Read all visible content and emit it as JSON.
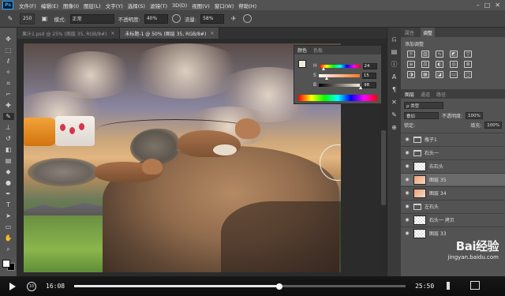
{
  "app": {
    "logo": "Ps"
  },
  "menu": [
    "文件(F)",
    "编辑(E)",
    "图像(I)",
    "图层(L)",
    "文字(Y)",
    "选择(S)",
    "滤镜(T)",
    "3D(D)",
    "视图(V)",
    "窗口(W)",
    "帮助(H)"
  ],
  "window_controls": {
    "minimize": "–",
    "maximize": "□",
    "close": "✕"
  },
  "options": {
    "brush_size": "250",
    "mode_label": "模式:",
    "mode_value": "正常",
    "opacity_label": "不透明度:",
    "opacity_value": "40%",
    "flow_label": "流量:",
    "flow_value": "58%"
  },
  "tabs": [
    {
      "label": "果汁1.psd @ 25% (图层 35, RGB/8#)",
      "close": "×",
      "active": false
    },
    {
      "label": "未标题-1 @ 50% (图层 35, RGB/8#)",
      "close": "×",
      "active": true
    }
  ],
  "toolbar_icons": [
    "move-icon",
    "marquee-icon",
    "lasso-icon",
    "quick-select-icon",
    "crop-icon",
    "eyedropper-icon",
    "healing-icon",
    "brush-icon",
    "stamp-icon",
    "history-brush-icon",
    "eraser-icon",
    "gradient-icon",
    "blur-icon",
    "dodge-icon",
    "pen-icon",
    "type-icon",
    "path-select-icon",
    "shape-icon",
    "hand-icon",
    "zoom-icon"
  ],
  "color_panel": {
    "tabs": [
      "颜色",
      "色板"
    ],
    "fg_color": "#f0ecd6",
    "sliders": [
      {
        "label": "H",
        "value": "24",
        "level": 0.07
      },
      {
        "label": "S",
        "value": "15",
        "level": 0.15
      },
      {
        "label": "B",
        "value": "98",
        "level": 0.98
      }
    ]
  },
  "right_panel": {
    "tabs": [
      "属性",
      "调整"
    ],
    "adjust_title": "添加调整",
    "layers_tabs": [
      "图层",
      "通道",
      "路径"
    ],
    "kind_label": "ρ 类型",
    "blend": "叠加",
    "opacity_label": "不透明度:",
    "opacity_value": "100%",
    "lock_label": "锁定:",
    "fill_label": "填充:",
    "fill_value": "100%",
    "layers": [
      {
        "name": "瓶子1",
        "type": "folder",
        "selected": false
      },
      {
        "name": "石头一",
        "type": "folder",
        "selected": false
      },
      {
        "name": "右石头",
        "type": "layer",
        "selected": false
      },
      {
        "name": "图层 35",
        "type": "layer",
        "selected": true
      },
      {
        "name": "图层 34",
        "type": "layer",
        "selected": false
      },
      {
        "name": "左石头",
        "type": "folder",
        "selected": false
      },
      {
        "name": "石头一 拷贝",
        "type": "layer",
        "selected": false
      },
      {
        "name": "图层 33",
        "type": "layer",
        "selected": false
      }
    ]
  },
  "video": {
    "current_time": "16:08",
    "total_time": "25:50",
    "progress": 0.62,
    "replay_label": "10"
  },
  "watermark": {
    "logo": "Bai经验",
    "url": "jingyan.baidu.com"
  }
}
